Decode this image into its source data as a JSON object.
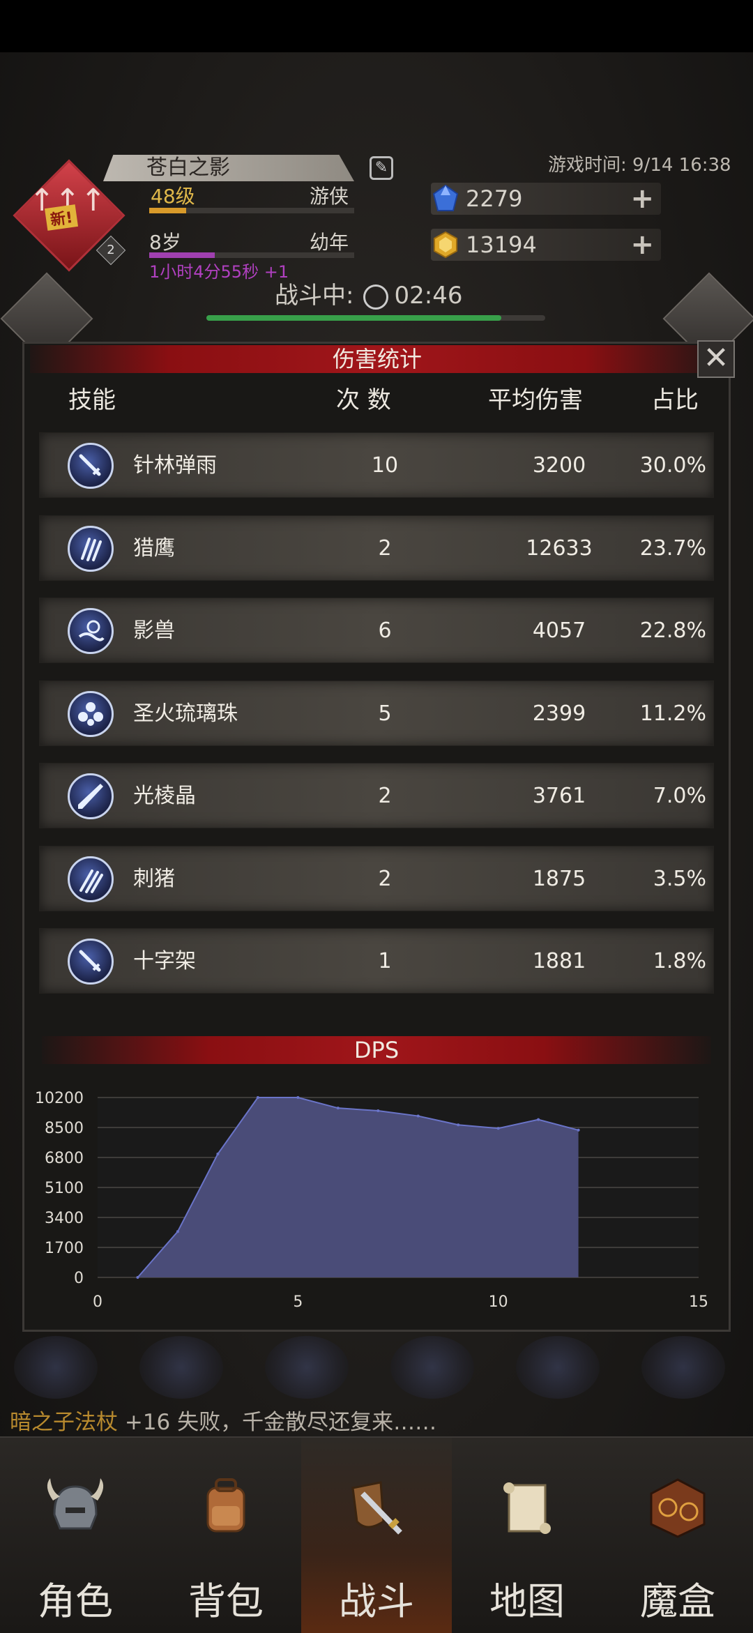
{
  "header": {
    "character_name": "苍白之影",
    "level": "48级",
    "class": "游侠",
    "age": "8岁",
    "age_stage": "幼年",
    "timer": "1小时4分55秒 +1",
    "rank_new": "新!",
    "rank_number": "2",
    "game_time": "游戏时间: 9/14 16:38",
    "gems": "2279",
    "gold": "13194",
    "battle_label": "战斗中:",
    "battle_time": "02:46",
    "battle_progress": 0.87
  },
  "panel": {
    "title": "伤害统计",
    "columns": [
      "技能",
      "次 数",
      "平均伤害",
      "占比"
    ],
    "skills": [
      {
        "name": "针林弹雨",
        "count": "10",
        "avg": "3200",
        "pct": "30.0%",
        "icon": "dagger-icon"
      },
      {
        "name": "猎鹰",
        "count": "2",
        "avg": "12633",
        "pct": "23.7%",
        "icon": "claw-icon"
      },
      {
        "name": "影兽",
        "count": "6",
        "avg": "4057",
        "pct": "22.8%",
        "icon": "beast-icon"
      },
      {
        "name": "圣火琉璃珠",
        "count": "5",
        "avg": "2399",
        "pct": "11.2%",
        "icon": "orbs-icon"
      },
      {
        "name": "光棱晶",
        "count": "2",
        "avg": "3761",
        "pct": "7.0%",
        "icon": "prism-icon"
      },
      {
        "name": "刺猪",
        "count": "2",
        "avg": "1875",
        "pct": "3.5%",
        "icon": "spikes-icon"
      },
      {
        "name": "十字架",
        "count": "1",
        "avg": "1881",
        "pct": "1.8%",
        "icon": "dagger-icon"
      }
    ],
    "close": "✕"
  },
  "chart_data": {
    "type": "area",
    "title": "DPS",
    "x": [
      1,
      2,
      3,
      4,
      5,
      6,
      7,
      8,
      9,
      10,
      11,
      12
    ],
    "values": [
      0,
      2600,
      7000,
      10200,
      10200,
      9600,
      9450,
      9150,
      8650,
      8450,
      8950,
      8350
    ],
    "xlim": [
      0,
      15
    ],
    "ylim": [
      0,
      10200
    ],
    "xticks": [
      "0",
      "5",
      "10",
      "15"
    ],
    "yticks": [
      "10200",
      "8500",
      "6800",
      "5100",
      "3400",
      "1700",
      "0"
    ],
    "fill_color": "#4a4c78",
    "line_color": "#6a74c8",
    "grid": true
  },
  "log": {
    "item": "暗之子法杖",
    "text": " +16 失败，千金散尽还复来……"
  },
  "nav": [
    {
      "label": "角色",
      "icon": "helmet-icon",
      "active": false
    },
    {
      "label": "背包",
      "icon": "backpack-icon",
      "active": false
    },
    {
      "label": "战斗",
      "icon": "sword-shield-icon",
      "active": true
    },
    {
      "label": "地图",
      "icon": "scroll-map-icon",
      "active": false
    },
    {
      "label": "魔盒",
      "icon": "magic-box-icon",
      "active": false
    }
  ]
}
